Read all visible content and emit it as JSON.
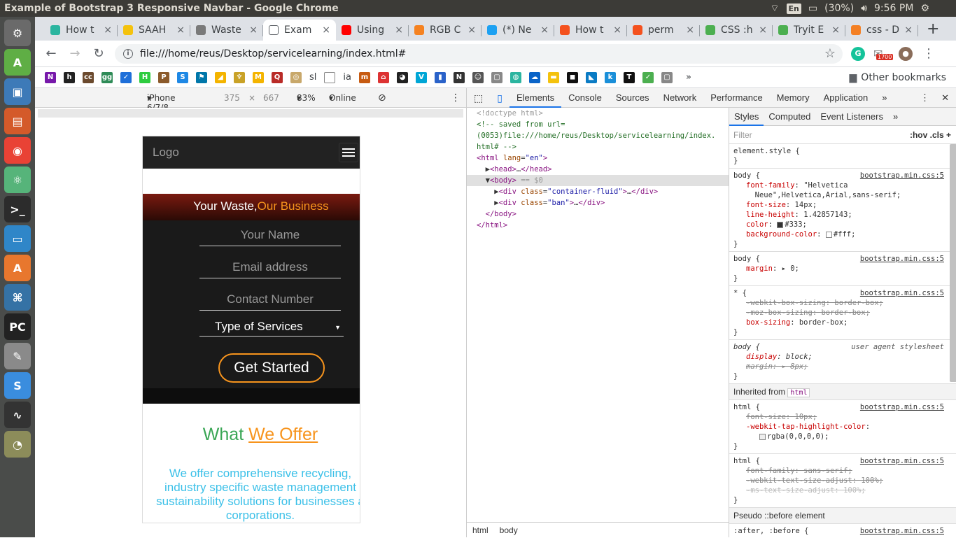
{
  "os": {
    "window_title": "Example of Bootstrap 3 Responsive Navbar - Google Chrome",
    "lang": "En",
    "battery": "(30%)",
    "time": "9:56 PM"
  },
  "launcher": [
    {
      "icon": "settings-icon",
      "glyph": "⚙",
      "color": "#6a6a6a"
    },
    {
      "icon": "inkscape-icon",
      "glyph": "A",
      "color": "#5fae45"
    },
    {
      "icon": "virtualbox-icon",
      "glyph": "▣",
      "color": "#3d7ab8"
    },
    {
      "icon": "files-icon",
      "glyph": "▤",
      "color": "#d45a2a"
    },
    {
      "icon": "chrome-icon",
      "glyph": "◉",
      "color": "#e94235"
    },
    {
      "icon": "atom-icon",
      "glyph": "⚛",
      "color": "#56b47a"
    },
    {
      "icon": "terminal-icon",
      "glyph": ">_",
      "color": "#2c2c2c"
    },
    {
      "icon": "vlc-icon",
      "glyph": "▭",
      "color": "#2f86c8"
    },
    {
      "icon": "software-center-icon",
      "glyph": "A",
      "color": "#e8772e"
    },
    {
      "icon": "python-icon",
      "glyph": "⌘",
      "color": "#3572a5"
    },
    {
      "icon": "pycharm-icon",
      "glyph": "PC",
      "color": "#222"
    },
    {
      "icon": "text-editor-icon",
      "glyph": "✎",
      "color": "#8a8a8a"
    },
    {
      "icon": "simplenote-icon",
      "glyph": "S",
      "color": "#3a8dde"
    },
    {
      "icon": "system-monitor-icon",
      "glyph": "∿",
      "color": "#333"
    },
    {
      "icon": "screenshot-icon",
      "glyph": "◔",
      "color": "#8c8c5a"
    }
  ],
  "browser": {
    "tabs": [
      {
        "label": "How t",
        "color": "#2bb5a0"
      },
      {
        "label": "SAAH",
        "color": "#f4c20d"
      },
      {
        "label": "Waste",
        "color": "#7a7a7a"
      },
      {
        "label": "Exam",
        "color": "#ffffff",
        "active": true
      },
      {
        "label": "Using",
        "color": "#ff0000"
      },
      {
        "label": "RGB C",
        "color": "#f58220"
      },
      {
        "label": "(*) Ne",
        "color": "#1da1f2"
      },
      {
        "label": "How t",
        "color": "#f4511e"
      },
      {
        "label": "perm",
        "color": "#f4511e"
      },
      {
        "label": "CSS :h",
        "color": "#4caf50"
      },
      {
        "label": "Tryit E",
        "color": "#4caf50"
      },
      {
        "label": "css - D",
        "color": "#f48024"
      }
    ],
    "url": "file:///home/reus/Desktop/servicelearning/index.html#",
    "ext_badge": "1700",
    "bookmarks": [
      {
        "t": "N",
        "c": "#7719aa"
      },
      {
        "t": "h",
        "c": "#222"
      },
      {
        "t": "cc",
        "c": "#6b4a2e"
      },
      {
        "t": "gg",
        "c": "#2e8b57"
      },
      {
        "t": "✓",
        "c": "#1e6fd9"
      },
      {
        "t": "H",
        "c": "#2ecc40"
      },
      {
        "t": "P",
        "c": "#8b5a2b"
      },
      {
        "t": "S",
        "c": "#1e88e5"
      },
      {
        "t": "⚑",
        "c": "#0077aa"
      },
      {
        "t": "◢",
        "c": "#f4b400"
      },
      {
        "t": "♆",
        "c": "#c9a227"
      },
      {
        "t": "M",
        "c": "#f4b400"
      },
      {
        "t": "Q",
        "c": "#b92b27"
      },
      {
        "t": "◎",
        "c": "#c8a86b"
      }
    ],
    "bookmark_texts": {
      "sl": "sl",
      "ia": "ia"
    },
    "bookmarks2": [
      {
        "t": "m",
        "c": "#c75b12"
      },
      {
        "t": "⌂",
        "c": "#d33"
      },
      {
        "t": "◕",
        "c": "#222"
      },
      {
        "t": "V",
        "c": "#00a6d6"
      },
      {
        "t": "▮",
        "c": "#2a62c9"
      },
      {
        "t": "N",
        "c": "#333"
      },
      {
        "t": "☺",
        "c": "#555"
      },
      {
        "t": "▢",
        "c": "#888"
      },
      {
        "t": "◍",
        "c": "#2bb5a0"
      },
      {
        "t": "☁",
        "c": "#0a64c8"
      },
      {
        "t": "▬",
        "c": "#f4c20d"
      },
      {
        "t": "◼",
        "c": "#111"
      },
      {
        "t": "◣",
        "c": "#0a7bc4"
      },
      {
        "t": "k",
        "c": "#1a8fd9"
      },
      {
        "t": "T",
        "c": "#111"
      },
      {
        "t": "✓",
        "c": "#4caf50"
      },
      {
        "t": "▢",
        "c": "#888"
      }
    ],
    "other_bookmarks": "Other bookmarks"
  },
  "device_toolbar": {
    "device": "iPhone 6/7/8",
    "width": "375",
    "times": "×",
    "height": "667",
    "zoom": "83%",
    "network": "Online"
  },
  "page": {
    "logo": "Logo",
    "headline_a": "Your Waste,",
    "headline_b": "Our Business",
    "name_ph": "Your Name",
    "email_ph": "Email address",
    "contact_ph": "Contact Number",
    "service_select": "Type of Services",
    "cta": "Get Started",
    "what": "What ",
    "offer": "We Offer",
    "offer_lines": [
      "We offer comprehensive recycling,",
      "industry specific waste management",
      "sustainability solutions for businesses a",
      "corporations."
    ]
  },
  "devtools": {
    "tabs": [
      "Elements",
      "Console",
      "Sources",
      "Network",
      "Performance",
      "Memory",
      "Application"
    ],
    "more": "»",
    "dom_lines": [
      {
        "html": "<span class='c-gray'>&lt;!doctype html&gt;</span>"
      },
      {
        "html": "<span class='c-com'>&lt;!-- saved from url=</span>"
      },
      {
        "html": "<span class='c-com'>(0053)file:///home/reus/Desktop/servicelearning/index.</span>"
      },
      {
        "html": "<span class='c-com'>html# --&gt;</span>"
      },
      {
        "html": "<span class='c-tag'>&lt;html</span> <span class='c-attr'>lang</span>=<span class='c-val'>\"en\"</span><span class='c-tag'>&gt;</span>"
      },
      {
        "html": "  ▶<span class='c-tag'>&lt;head&gt;</span>…<span class='c-tag'>&lt;/head&gt;</span>"
      },
      {
        "html": "  ▼<span class='c-tag'>&lt;body&gt;</span> <span class='c-gray'>== $0</span>",
        "sel": true
      },
      {
        "html": "    ▶<span class='c-tag'>&lt;div</span> <span class='c-attr'>class</span>=<span class='c-val'>\"container-fluid\"</span><span class='c-tag'>&gt;</span>…<span class='c-tag'>&lt;/div&gt;</span>"
      },
      {
        "html": "    ▶<span class='c-tag'>&lt;div</span> <span class='c-attr'>class</span>=<span class='c-val'>\"ban\"</span><span class='c-tag'>&gt;</span>…<span class='c-tag'>&lt;/div&gt;</span>"
      },
      {
        "html": "  <span class='c-tag'>&lt;/body&gt;</span>"
      },
      {
        "html": "<span class='c-tag'>&lt;/html&gt;</span>"
      }
    ],
    "crumbs": [
      "html",
      "body"
    ],
    "styles_tabs": [
      "Styles",
      "Computed",
      "Event Listeners"
    ],
    "filter_ph": "Filter",
    "filter_right": ":hov  .cls  +",
    "src": "bootstrap.min.css:5",
    "ua": "user agent stylesheet",
    "inherited": "Inherited from",
    "inherited_tag": "html",
    "pseudo": "Pseudo ::before element",
    "pseudo_sel": ":after, :before {"
  }
}
